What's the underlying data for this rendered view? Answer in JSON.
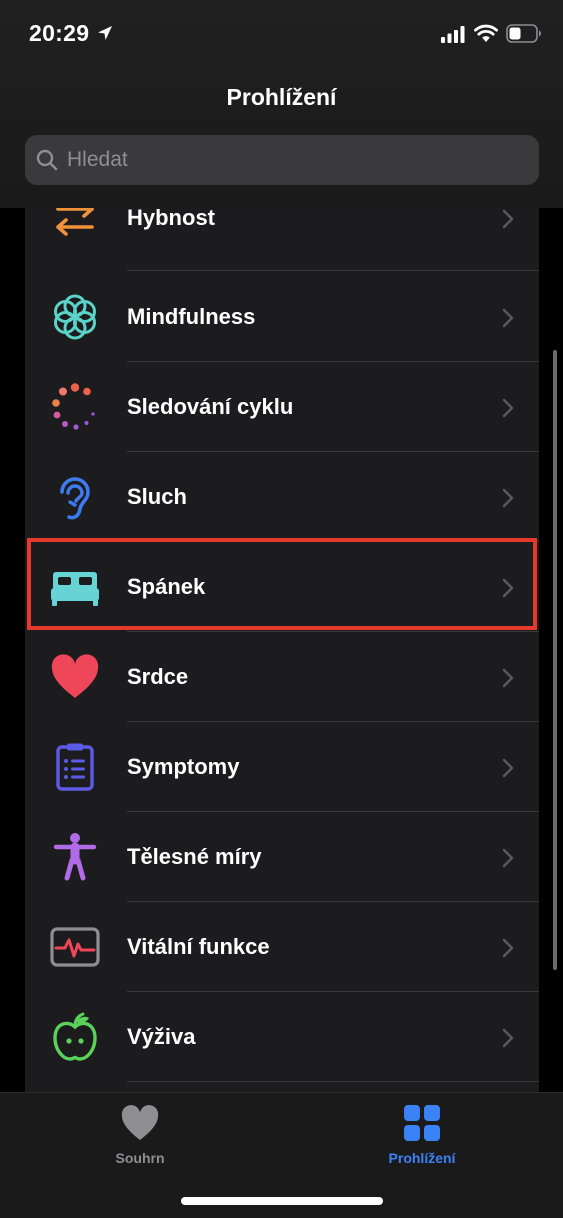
{
  "status_bar": {
    "time": "20:29"
  },
  "navigation": {
    "title": "Prohlížení"
  },
  "search": {
    "placeholder": "Hledat"
  },
  "categories": [
    {
      "label": "Hybnost",
      "icon": "arrows-icon",
      "color": "#f0923c"
    },
    {
      "label": "Mindfulness",
      "icon": "flower-icon",
      "color": "#5ad3c8"
    },
    {
      "label": "Sledování cyklu",
      "icon": "cycle-dots-icon",
      "color": "#f06a6a"
    },
    {
      "label": "Sluch",
      "icon": "ear-icon",
      "color": "#3c7cf0"
    },
    {
      "label": "Spánek",
      "icon": "bed-icon",
      "color": "#66d4d4"
    },
    {
      "label": "Srdce",
      "icon": "heart-icon",
      "color": "#f0465a"
    },
    {
      "label": "Symptomy",
      "icon": "clipboard-icon",
      "color": "#5b5be6"
    },
    {
      "label": "Tělesné míry",
      "icon": "body-figure-icon",
      "color": "#b26be6"
    },
    {
      "label": "Vitální funkce",
      "icon": "vitals-monitor-icon",
      "color": "#f0465a"
    },
    {
      "label": "Výživa",
      "icon": "apple-icon",
      "color": "#5ad35a"
    }
  ],
  "highlighted_item": "Spánek",
  "highlight_color": "#e5392d",
  "tab_bar": {
    "tabs": [
      {
        "label": "Souhrn",
        "icon": "heart-icon",
        "selected": false
      },
      {
        "label": "Prohlížení",
        "icon": "grid-icon",
        "selected": true
      }
    ],
    "accent_color": "#3b82f6"
  }
}
